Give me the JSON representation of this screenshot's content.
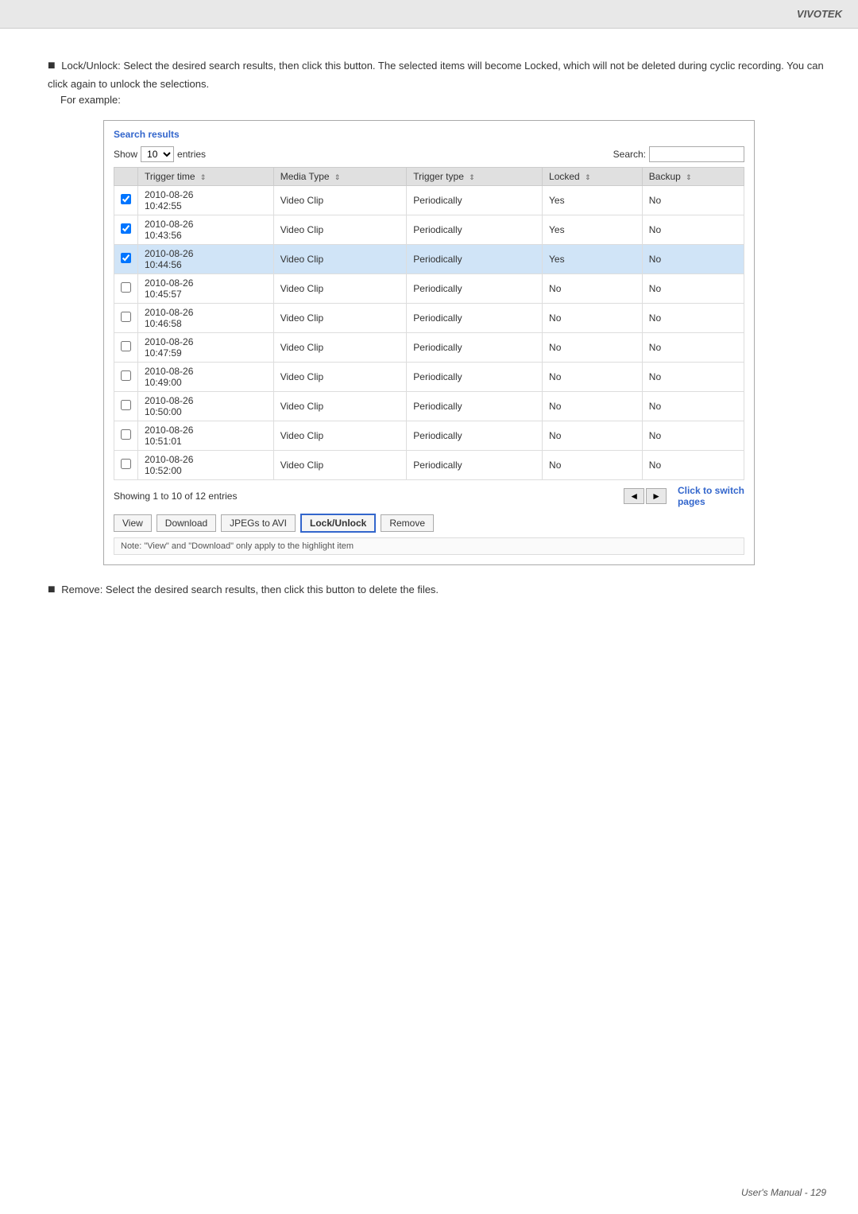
{
  "brand": "VIVOTEK",
  "header": {
    "title": "Search results"
  },
  "intro": {
    "bullet": "■",
    "text": "Lock/Unlock: Select the desired search results, then click this button. The selected items will become Locked, which will not be deleted during cyclic recording. You can click again to unlock the selections.",
    "example_label": "For example:"
  },
  "search_panel": {
    "title": "Search results",
    "show_label": "Show",
    "show_value": "10",
    "entries_label": "entries",
    "search_label": "Search:",
    "search_placeholder": "",
    "columns": [
      {
        "label": "",
        "sortable": false
      },
      {
        "label": "Trigger time",
        "sortable": true
      },
      {
        "label": "Media Type",
        "sortable": true
      },
      {
        "label": "Trigger type",
        "sortable": true
      },
      {
        "label": "Locked",
        "sortable": true
      },
      {
        "label": "Backup",
        "sortable": true
      }
    ],
    "rows": [
      {
        "checked": true,
        "trigger_time": "2010-08-26\n10:42:55",
        "media_type": "Video Clip",
        "trigger_type": "Periodically",
        "locked": "Yes",
        "backup": "No",
        "highlighted": false
      },
      {
        "checked": true,
        "trigger_time": "2010-08-26\n10:43:56",
        "media_type": "Video Clip",
        "trigger_type": "Periodically",
        "locked": "Yes",
        "backup": "No",
        "highlighted": false
      },
      {
        "checked": true,
        "trigger_time": "2010-08-26\n10:44:56",
        "media_type": "Video Clip",
        "trigger_type": "Periodically",
        "locked": "Yes",
        "backup": "No",
        "highlighted": true
      },
      {
        "checked": false,
        "trigger_time": "2010-08-26\n10:45:57",
        "media_type": "Video Clip",
        "trigger_type": "Periodically",
        "locked": "No",
        "backup": "No",
        "highlighted": false
      },
      {
        "checked": false,
        "trigger_time": "2010-08-26\n10:46:58",
        "media_type": "Video Clip",
        "trigger_type": "Periodically",
        "locked": "No",
        "backup": "No",
        "highlighted": false
      },
      {
        "checked": false,
        "trigger_time": "2010-08-26\n10:47:59",
        "media_type": "Video Clip",
        "trigger_type": "Periodically",
        "locked": "No",
        "backup": "No",
        "highlighted": false
      },
      {
        "checked": false,
        "trigger_time": "2010-08-26\n10:49:00",
        "media_type": "Video Clip",
        "trigger_type": "Periodically",
        "locked": "No",
        "backup": "No",
        "highlighted": false
      },
      {
        "checked": false,
        "trigger_time": "2010-08-26\n10:50:00",
        "media_type": "Video Clip",
        "trigger_type": "Periodically",
        "locked": "No",
        "backup": "No",
        "highlighted": false
      },
      {
        "checked": false,
        "trigger_time": "2010-08-26\n10:51:01",
        "media_type": "Video Clip",
        "trigger_type": "Periodically",
        "locked": "No",
        "backup": "No",
        "highlighted": false
      },
      {
        "checked": false,
        "trigger_time": "2010-08-26\n10:52:00",
        "media_type": "Video Clip",
        "trigger_type": "Periodically",
        "locked": "No",
        "backup": "No",
        "highlighted": false
      }
    ],
    "showing_text": "Showing 1 to 10 of 12 entries",
    "click_to_switch": "Click to switch\npages",
    "pagination": {
      "prev": "◄",
      "next": "►"
    }
  },
  "actions": {
    "view_label": "View",
    "download_label": "Download",
    "jpegs_label": "JPEGs to AVI",
    "lock_unlock_label": "Lock/Unlock",
    "remove_label": "Remove",
    "note_text": "Note: \"View\" and \"Download\" only apply to the highlight item"
  },
  "remove_section": {
    "bullet": "■",
    "text": "Remove: Select the desired search results, then click this button to delete the files."
  },
  "footer": {
    "page_text": "User's Manual - 129"
  }
}
